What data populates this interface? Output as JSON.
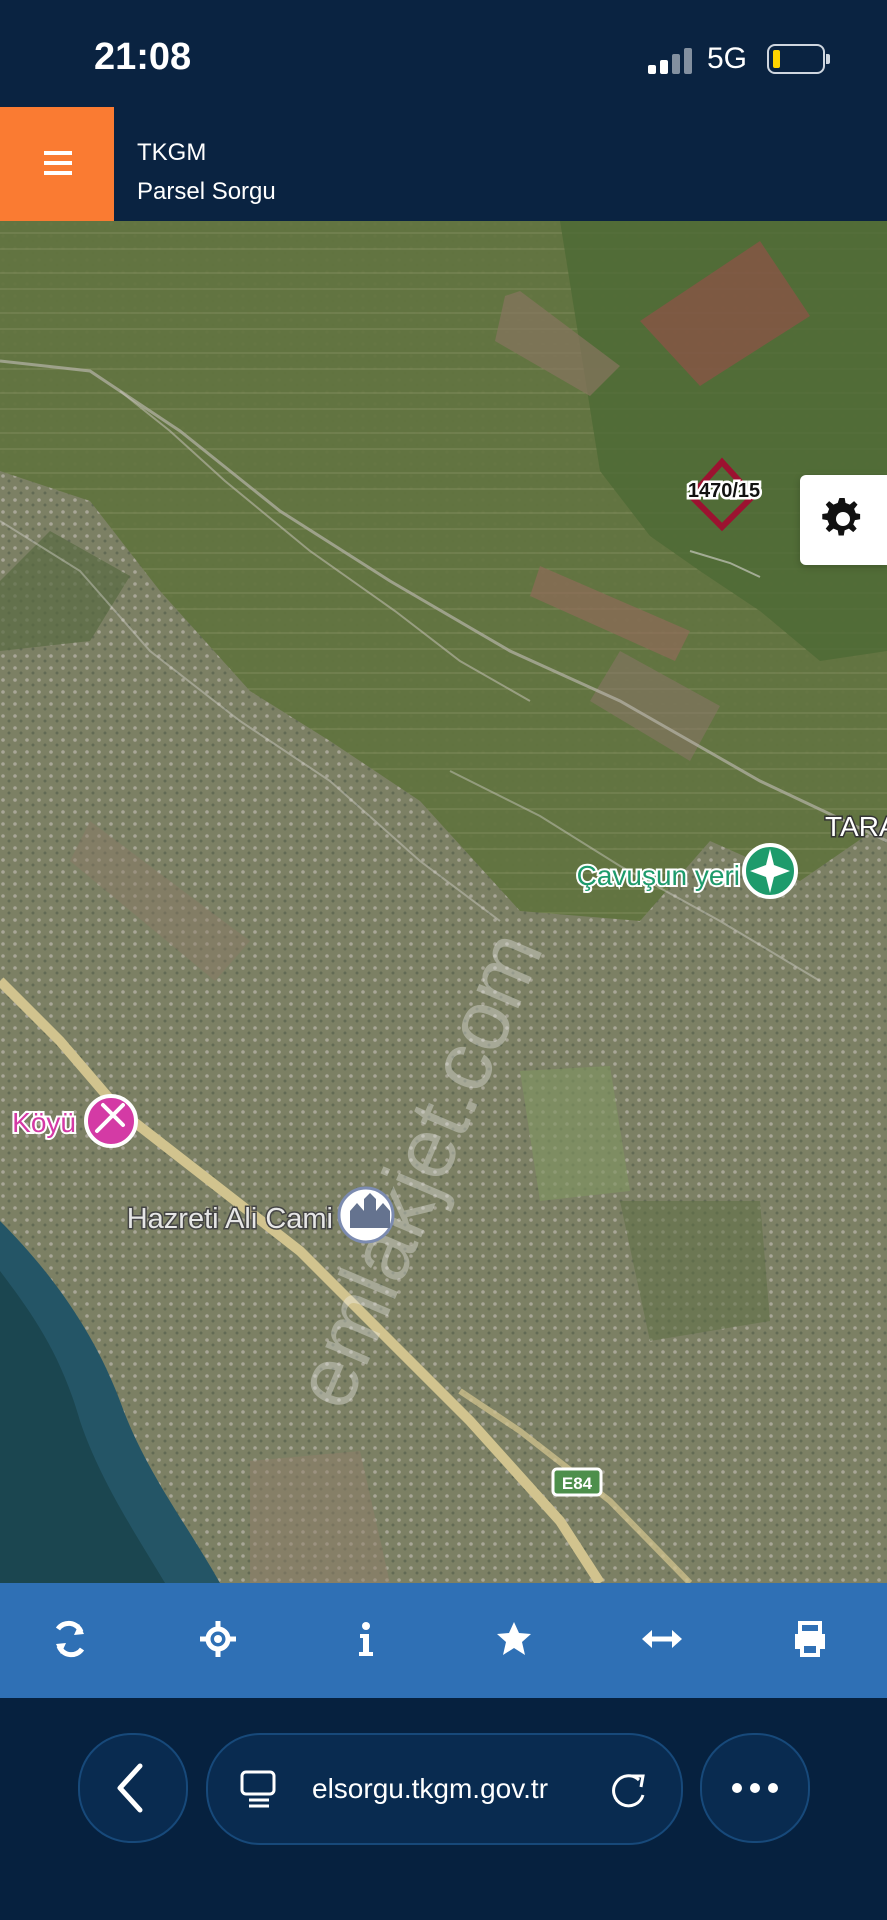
{
  "status_bar": {
    "time": "21:08",
    "network": "5G",
    "battery_level": 0.12
  },
  "header": {
    "menu_icon": "hamburger-menu-icon",
    "title": "TKGM",
    "subtitle": "Parsel Sorgu"
  },
  "map": {
    "parcel_label": "1470/15",
    "watermark": "emlakjet.com",
    "places": {
      "cavusun_yeri": "Çavuşun yeri",
      "koyu": "Köyü",
      "hazreti_ali_cami": "Hazreti Ali Cami",
      "taraf": "TARA"
    },
    "road_label": "E84",
    "settings_icon": "gear-icon"
  },
  "toolbar": {
    "buttons": [
      {
        "name": "refresh-icon"
      },
      {
        "name": "locate-icon"
      },
      {
        "name": "info-icon"
      },
      {
        "name": "star-icon"
      },
      {
        "name": "measure-icon"
      },
      {
        "name": "print-icon"
      }
    ]
  },
  "browser": {
    "url": "elsorgu.tkgm.gov.tr",
    "back_icon": "chevron-left-icon",
    "page_icon": "page-icon",
    "reload_icon": "reload-icon",
    "more_icon": "more-icon"
  },
  "colors": {
    "header_bg": "#0a2341",
    "menu_button": "#fa7b32",
    "toolbar_bg": "#2f70b5",
    "parcel_outline": "#9c1230",
    "poi_green": "#1e9b6c",
    "poi_pink": "#d43aa5"
  }
}
